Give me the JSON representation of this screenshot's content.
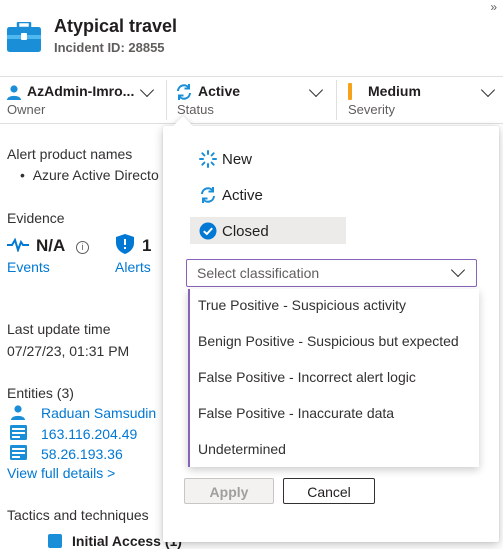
{
  "header": {
    "title": "Atypical travel",
    "incident_id": "Incident ID: 28855",
    "collapse_glyph": "»"
  },
  "fields": {
    "owner": {
      "value": "AzAdmin-Imro...",
      "label": "Owner"
    },
    "status": {
      "value": "Active",
      "label": "Status"
    },
    "severity": {
      "value": "Medium",
      "label": "Severity",
      "color": "#f7a21b"
    }
  },
  "details": {
    "alert_product_names_title": "Alert product names",
    "alert_product_item": "Azure Active Directo",
    "evidence_title": "Evidence",
    "events_value": "N/A",
    "events_label": "Events",
    "alerts_value": "1",
    "alerts_label": "Alerts",
    "last_update_title": "Last update time",
    "last_update_value": "07/27/23, 01:31 PM",
    "entities_title": "Entities (3)",
    "entities": [
      "Raduan Samsudin",
      "163.116.204.49",
      "58.26.193.36"
    ],
    "view_full_details": "View full details >",
    "tactics_title": "Tactics and techniques",
    "tactics_partial": "Initial Access (1)"
  },
  "status_panel": {
    "options": [
      "New",
      "Active",
      "Closed"
    ],
    "selected": "Closed",
    "classification_placeholder": "Select classification",
    "classification_options": [
      "True Positive - Suspicious activity",
      "Benign Positive - Suspicious but expected",
      "False Positive - Incorrect alert logic",
      "False Positive - Inaccurate data",
      "Undetermined"
    ],
    "apply_label": "Apply",
    "cancel_label": "Cancel"
  },
  "colors": {
    "accent": "#0078d4",
    "focus_border": "#8764b8",
    "selected_bg": "#edebe9"
  }
}
